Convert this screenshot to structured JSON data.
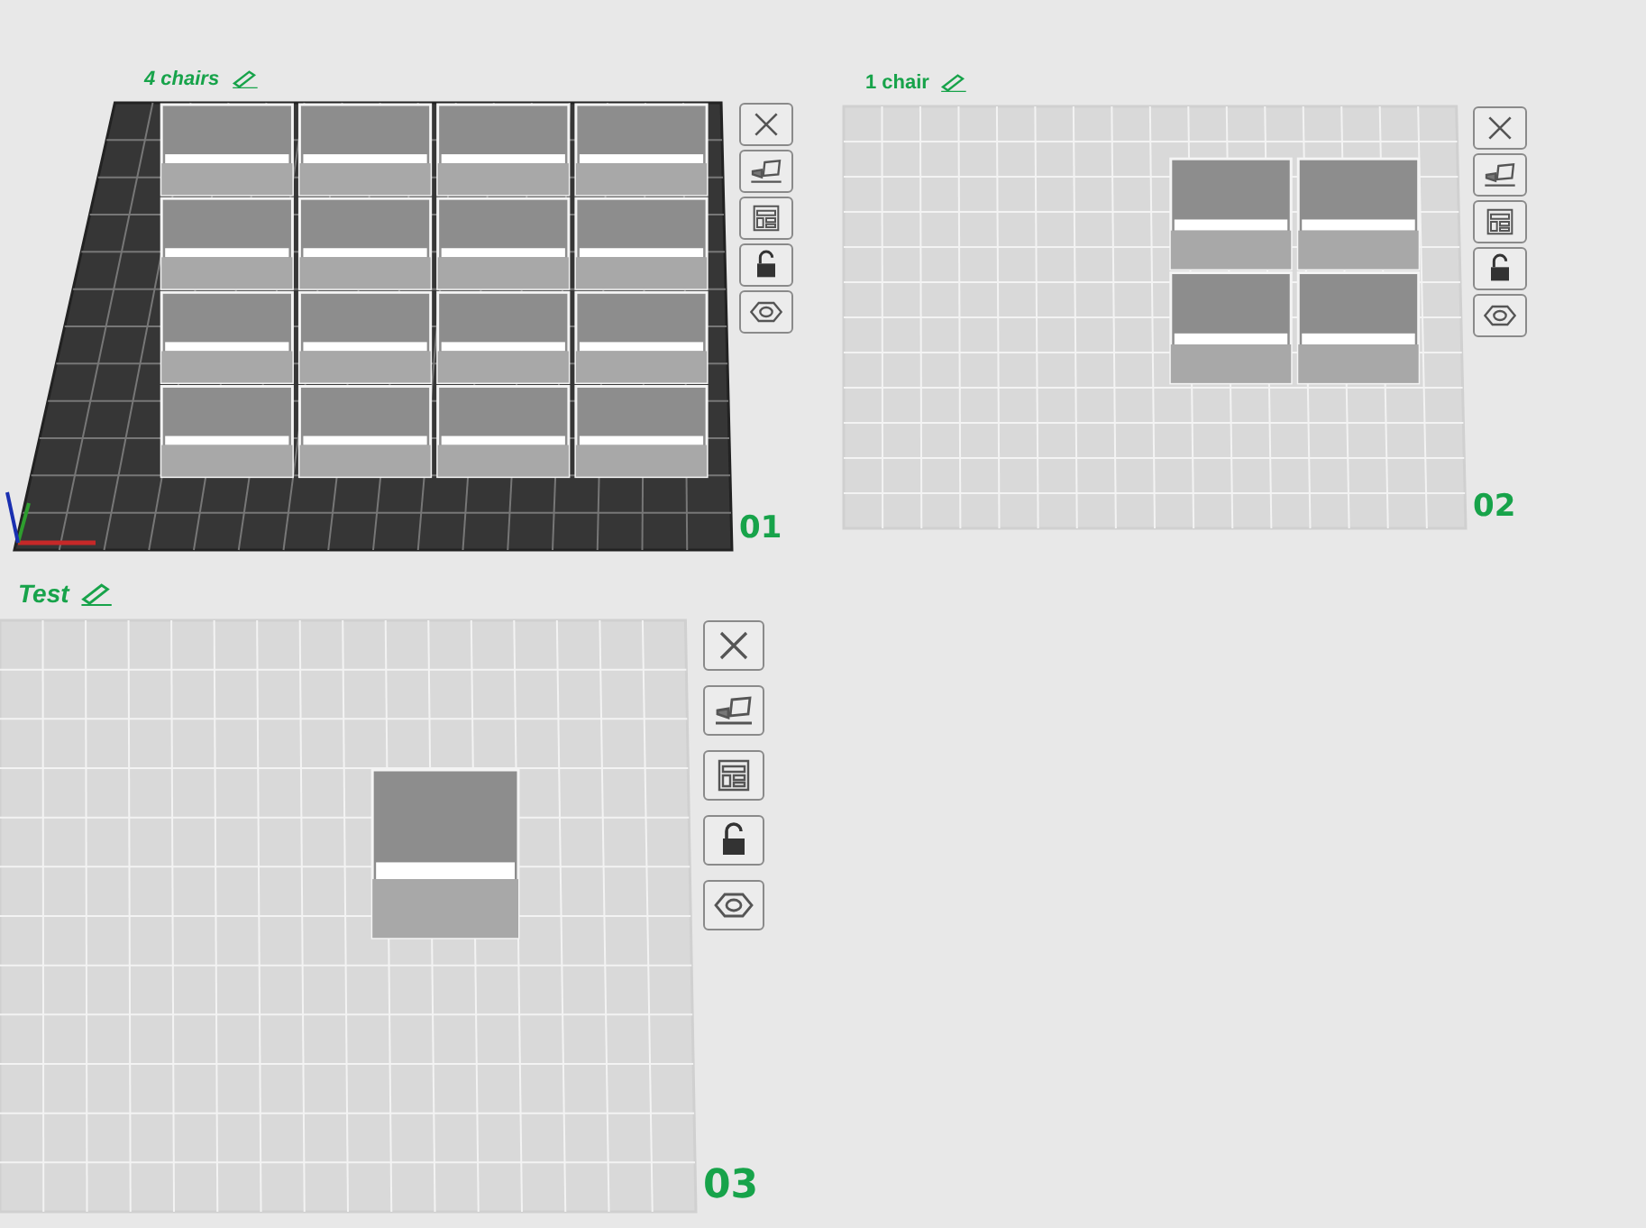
{
  "plates": [
    {
      "name": "4 chairs",
      "number": "01",
      "selected": true,
      "locked": false,
      "objects": [
        {
          "kind": "bin"
        },
        {
          "kind": "bin"
        },
        {
          "kind": "bin"
        },
        {
          "kind": "bin"
        },
        {
          "kind": "bin"
        },
        {
          "kind": "bin"
        },
        {
          "kind": "bin"
        },
        {
          "kind": "bin"
        },
        {
          "kind": "bin"
        },
        {
          "kind": "bin"
        },
        {
          "kind": "bin"
        },
        {
          "kind": "bin"
        },
        {
          "kind": "bin"
        },
        {
          "kind": "bin"
        },
        {
          "kind": "bin"
        },
        {
          "kind": "bin"
        }
      ]
    },
    {
      "name": "1 chair",
      "number": "02",
      "selected": false,
      "locked": false,
      "objects": [
        {
          "kind": "bin"
        },
        {
          "kind": "bin"
        },
        {
          "kind": "bin"
        },
        {
          "kind": "bin"
        }
      ]
    },
    {
      "name": "Test",
      "number": "03",
      "selected": false,
      "locked": false,
      "objects": [
        {
          "kind": "bin"
        }
      ]
    }
  ]
}
